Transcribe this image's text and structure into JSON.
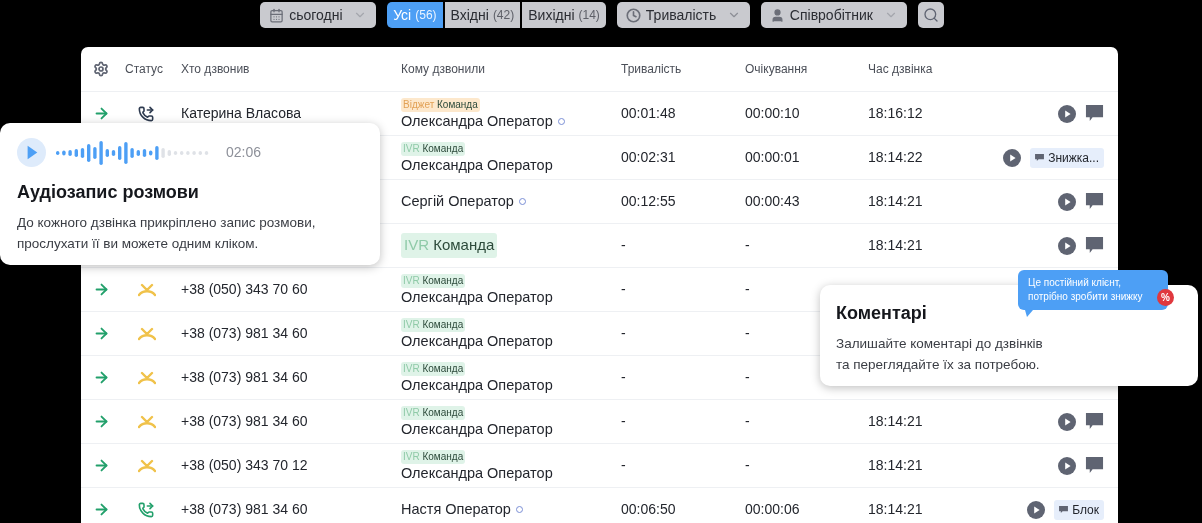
{
  "filters": {
    "date": {
      "label": "сьогодні"
    },
    "segments": [
      {
        "label": "Усі",
        "count": "(56)",
        "selected": true
      },
      {
        "label": "Вхідні",
        "count": "(42)",
        "selected": false
      },
      {
        "label": "Вихідні",
        "count": "(14)",
        "selected": false
      }
    ],
    "duration": {
      "label": "Тривалість"
    },
    "employee": {
      "label": "Співробітник"
    }
  },
  "table": {
    "columns": [
      "Статус",
      "Хто дзвонив",
      "Кому дзвонили",
      "Тривалість",
      "Очікування",
      "Час дзвінка"
    ],
    "rows": [
      {
        "kind": "forwarded",
        "caller": "Катерина Власова",
        "tag": {
          "kind": "widget",
          "source": "Віджет",
          "team": "Команда"
        },
        "operator": "Олександра Оператор",
        "online": true,
        "duration": "00:01:48",
        "wait": "00:00:10",
        "time": "18:16:12",
        "actions": {
          "kind": "icon"
        }
      },
      {
        "tag": {
          "kind": "ivr",
          "source": "IVR",
          "team": "Команда"
        },
        "operator": "Олександра Оператор",
        "online": false,
        "duration": "00:02:31",
        "wait": "00:00:01",
        "time": "18:14:22",
        "actions": {
          "kind": "note",
          "note": "Знижка..."
        }
      },
      {
        "operator": "Сергій Оператор",
        "online": true,
        "duration": "00:12:55",
        "wait": "00:00:43",
        "time": "18:14:21",
        "actions": {
          "kind": "icon"
        }
      },
      {
        "tag": {
          "kind": "ivr",
          "source": "IVR",
          "team": "Команда"
        },
        "duration": "-",
        "wait": "-",
        "time": "18:14:21",
        "actions": {
          "kind": "icon"
        }
      },
      {
        "kind": "missed",
        "caller": "+38 (050) 343 70 60",
        "tag": {
          "kind": "ivr",
          "source": "IVR",
          "team": "Команда"
        },
        "operator": "Олександра Оператор",
        "online": false,
        "duration": "-",
        "wait": "-"
      },
      {
        "kind": "missed",
        "caller": "+38 (073) 981 34 60",
        "tag": {
          "kind": "ivr",
          "source": "IVR",
          "team": "Команда"
        },
        "operator": "Олександра Оператор",
        "online": false,
        "duration": "-",
        "wait": "-"
      },
      {
        "kind": "missed",
        "caller": "+38 (073) 981 34 60",
        "tag": {
          "kind": "ivr",
          "source": "IVR",
          "team": "Команда"
        },
        "operator": "Олександра Оператор",
        "online": false,
        "duration": "-",
        "wait": "-"
      },
      {
        "kind": "missed",
        "caller": "+38 (073) 981 34 60",
        "tag": {
          "kind": "ivr",
          "source": "IVR",
          "team": "Команда"
        },
        "operator": "Олександра Оператор",
        "online": false,
        "duration": "-",
        "wait": "-",
        "time": "18:14:21",
        "actions": {
          "kind": "icon"
        }
      },
      {
        "kind": "missed",
        "caller": "+38 (050) 343 70 12",
        "tag": {
          "kind": "ivr",
          "source": "IVR",
          "team": "Команда"
        },
        "operator": "Олександра Оператор",
        "online": false,
        "duration": "-",
        "wait": "-",
        "time": "18:14:21",
        "actions": {
          "kind": "icon"
        }
      },
      {
        "kind": "answered",
        "caller": "+38 (073) 981 34 60",
        "operator": "Настя Оператор",
        "online": true,
        "duration": "00:06:50",
        "wait": "00:00:06",
        "time": "18:14:21",
        "actions": {
          "kind": "note",
          "note": "Блок"
        }
      }
    ]
  },
  "audio_card": {
    "time": "02:06",
    "title": "Аудіозапис розмови",
    "text": "До кожного дзвінка прикріплено запис розмови,\nпрослухати її ви можете одним кліком."
  },
  "comments_card": {
    "title": "Коментарі",
    "text": "Залишайте коментарі до дзвінків\nта переглядайте їх за потребою.",
    "bubble": "Це постійний клієнт,\nпотрібно зробити знижку",
    "badge": "%"
  }
}
